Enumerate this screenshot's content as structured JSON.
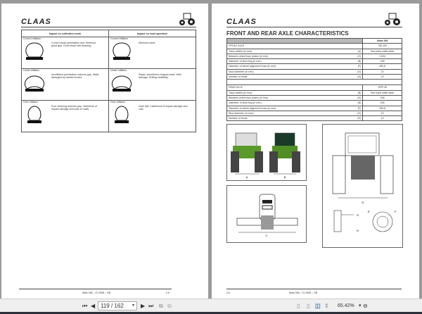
{
  "brand": "CLAAS",
  "left_page": {
    "col_headers": [
      "Impact on cultivation work",
      "Impact on road operation"
    ],
    "rows": [
      {
        "label": "Correct inflation",
        "cultivation": "Correct tread penetration and, therefore, good grip. Good tread self-cleaning.",
        "road": "Minimum wear."
      },
      {
        "label": "Under inflation",
        "cultivation": "Insufficient penetration reduces grip. Walls damaged by traction forces.",
        "road": "Rapid, sometimes irregular wear. Wall damage. Rolling instability."
      },
      {
        "label": "Over inflation",
        "cultivation": "Poor cleaning reduces grip. Likelihood of impact damage and cuts on walls.",
        "road": "Hard ride. Likelihood of impact damage and cuts."
      }
    ],
    "footer": "Atlas 946 – 07.2008 – GB",
    "page_no": "2.5"
  },
  "right_page": {
    "title": "FRONT AND REAR AXLE CHARACTERISTICS",
    "model": "Atlas 946",
    "front": {
      "label": "FRONT AXLE",
      "value": "755.100",
      "rows": [
        [
          "Track widths (in mm)",
          "(A)",
          "See track width table"
        ],
        [
          "Between wheel face plates (in mm)",
          "(C)",
          "1.524"
        ],
        [
          "Diameter of stud ring (in mm)",
          "(B)",
          "335"
        ],
        [
          "Diameter of wheel alignment boss (in mm)",
          "(F)",
          "280,8"
        ],
        [
          "Stud diameter (in mm)",
          "(G)",
          "22"
        ],
        [
          "Number of studs",
          "(H)",
          "10"
        ]
      ]
    },
    "rear": {
      "label": "REAR AXLE",
      "value": "GPR 35",
      "rows": [
        [
          "Track widths (in mm)",
          "(B)",
          "See track width table"
        ],
        [
          "Between wheel face plates (in mm)",
          "(D)",
          "538"
        ],
        [
          "Diameter of stud ring (in mm)",
          "(B)",
          "335"
        ],
        [
          "Diameter of wheel alignment boss (in mm)",
          "(F)",
          "280,8"
        ],
        [
          "Stud diameter (in mm)",
          "(G)",
          "22"
        ],
        [
          "Number of studs",
          "(H)",
          "10"
        ]
      ]
    },
    "labels": {
      "a": "A",
      "b": "B",
      "c": "C",
      "d": "D",
      "e": "E",
      "f": "F",
      "g": "G",
      "h": "H"
    },
    "footer": "Atlas 946 – 07.2008 – GB",
    "page_no": "2.6"
  },
  "toolbar": {
    "page_value": "119 / 162",
    "zoom": "65.42%"
  }
}
